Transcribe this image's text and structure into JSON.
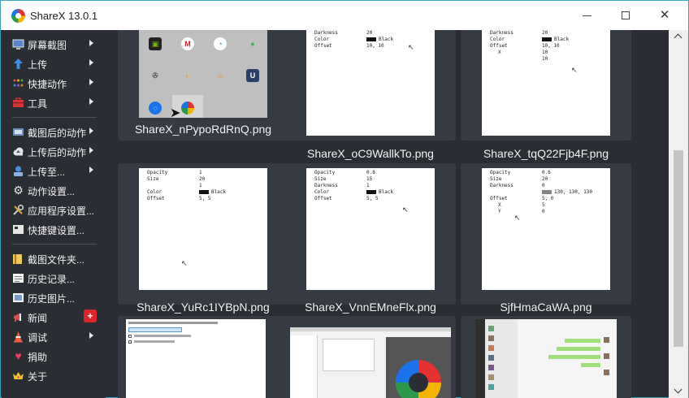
{
  "window": {
    "title": "ShareX 13.0.1",
    "accent": "#3aa0b4"
  },
  "sidebar": {
    "items": [
      {
        "label": "屏幕截图",
        "icon": "monitor-icon",
        "submenu": true
      },
      {
        "label": "上传",
        "icon": "upload-arrow-icon",
        "submenu": true
      },
      {
        "label": "快捷动作",
        "icon": "dots-grid-icon",
        "submenu": true
      },
      {
        "label": "工具",
        "icon": "toolbox-icon",
        "submenu": true
      },
      {
        "label": "截图后的动作",
        "icon": "after-capture-icon",
        "submenu": true
      },
      {
        "label": "上传后的动作",
        "icon": "cloud-icon",
        "submenu": true
      },
      {
        "label": "上传至...",
        "icon": "destinations-icon",
        "submenu": true
      },
      {
        "label": "动作设置...",
        "icon": "gear-icon",
        "submenu": false
      },
      {
        "label": "应用程序设置...",
        "icon": "wrench-icon",
        "submenu": false
      },
      {
        "label": "快捷键设置...",
        "icon": "keyboard-icon",
        "submenu": false
      },
      {
        "label": "截图文件夹...",
        "icon": "folder-icon",
        "submenu": false
      },
      {
        "label": "历史记录...",
        "icon": "history-icon",
        "submenu": false
      },
      {
        "label": "历史图片...",
        "icon": "image-history-icon",
        "submenu": false
      },
      {
        "label": "新闻",
        "icon": "megaphone-icon",
        "submenu": false,
        "badge": "+"
      },
      {
        "label": "调试",
        "icon": "traffic-cone-icon",
        "submenu": true
      },
      {
        "label": "捐助",
        "icon": "heart-icon",
        "submenu": false
      },
      {
        "label": "关于",
        "icon": "crown-icon",
        "submenu": false
      }
    ]
  },
  "grid": {
    "files": [
      "ShareX_nPypoRdRnQ.png",
      "ShareX_oC9WallkTo.png",
      "ShareX_tqQ22Fjb4F.png",
      "ShareX_YuRc1IYBpN.png",
      "ShareX_VnnEMneFlx.png",
      "SjfHmaCaWA.png",
      "",
      "",
      ""
    ]
  },
  "thumbs": {
    "t2": [
      {
        "k": "Darkness",
        "v": "20"
      },
      {
        "k": "Color",
        "v": "Black",
        "swatch": "#111111"
      },
      {
        "k": "Offset",
        "v": "10, 10"
      }
    ],
    "t3": [
      {
        "k": "Darkness",
        "v": "20"
      },
      {
        "k": "Color",
        "v": "Black",
        "swatch": "#111111"
      },
      {
        "k": "Offset",
        "v": "10, 10"
      },
      {
        "k": "X",
        "v": "10"
      },
      {
        "k": "Y",
        "v": "10"
      }
    ],
    "t4": [
      {
        "k": "Opacity",
        "v": "1"
      },
      {
        "k": "Size",
        "v": "20"
      },
      {
        "k": "Darkness",
        "v": "1"
      },
      {
        "k": "Color",
        "v": "Black",
        "swatch": "#111111"
      },
      {
        "k": "Offset",
        "v": "5, 5"
      }
    ],
    "t5": [
      {
        "k": "Opacity",
        "v": "0.8"
      },
      {
        "k": "Size",
        "v": "15"
      },
      {
        "k": "Darkness",
        "v": "1"
      },
      {
        "k": "Color",
        "v": "Black",
        "swatch": "#111111"
      },
      {
        "k": "Offset",
        "v": "5, 5"
      }
    ],
    "t6": [
      {
        "k": "Opacity",
        "v": "0.6"
      },
      {
        "k": "Size",
        "v": "20"
      },
      {
        "k": "Darkness",
        "v": "0"
      },
      {
        "k": "Color",
        "v": "130, 130, 130",
        "swatch": "#828282"
      },
      {
        "k": "Offset",
        "v": "5, 0"
      },
      {
        "k": "X",
        "v": "5"
      },
      {
        "k": "Y",
        "v": "0"
      }
    ]
  }
}
